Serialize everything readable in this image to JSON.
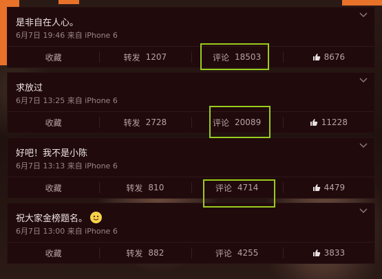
{
  "posts": [
    {
      "text": "是非自在人心。",
      "meta": "6月7日 19:46 来自 iPhone 6",
      "fav_label": "收藏",
      "repost_label": "转发",
      "repost_count": "1207",
      "comment_label": "评论",
      "comment_count": "18503",
      "like_count": "8676",
      "emoji": ""
    },
    {
      "text": "求放过",
      "meta": "6月7日 13:25 来自 iPhone 6",
      "fav_label": "收藏",
      "repost_label": "转发",
      "repost_count": "2728",
      "comment_label": "评论",
      "comment_count": "20089",
      "like_count": "11228",
      "emoji": ""
    },
    {
      "text": "好吧！我不是小陈",
      "meta": "6月7日 13:13 来自 iPhone 6",
      "fav_label": "收藏",
      "repost_label": "转发",
      "repost_count": "810",
      "comment_label": "评论",
      "comment_count": "4714",
      "like_count": "4479",
      "emoji": ""
    },
    {
      "text": "祝大家金榜题名。",
      "meta": "6月7日 13:00 来自 iPhone 6",
      "fav_label": "收藏",
      "repost_label": "转发",
      "repost_count": "882",
      "comment_label": "评论",
      "comment_count": "4255",
      "like_count": "3833",
      "emoji": "smile-emoji"
    }
  ],
  "colors": {
    "highlight": "#9acd1e",
    "card_bg": "#200a0c",
    "accent_orange": "#e8722a"
  }
}
